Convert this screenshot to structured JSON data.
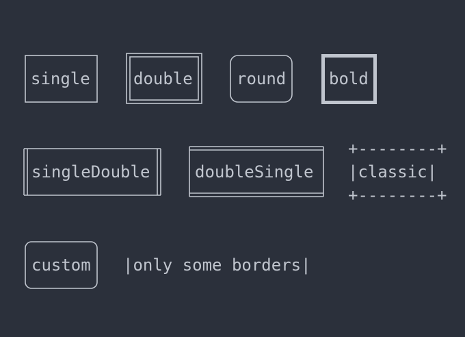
{
  "terminal": {
    "background": "#2b303b",
    "foreground": "#c0c5ce"
  },
  "boxes": {
    "single": "single",
    "double": "double",
    "round": "round",
    "bold": "bold",
    "single_double": "singleDouble",
    "double_single": "doubleSingle",
    "classic_top": "+--------+",
    "classic_middle": "|classic|",
    "classic_bottom": "+--------+",
    "custom": "custom",
    "only_some_borders": "|only some borders|"
  }
}
